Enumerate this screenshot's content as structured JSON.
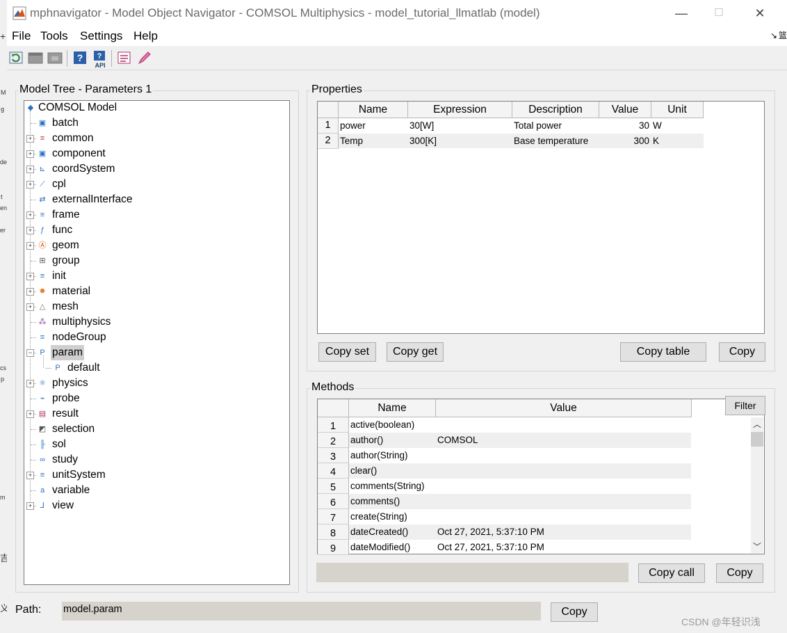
{
  "window": {
    "title": "mphnavigator - Model Object Navigator - COMSOL Multiphysics - model_tutorial_llmatlab (model)",
    "minimize": "—",
    "maximize": "☐",
    "close": "✕"
  },
  "menu": [
    "File",
    "Tools",
    "Settings",
    "Help"
  ],
  "toolbar_icons": [
    "refresh-icon",
    "collapse-icon",
    "expand-icon",
    "help-icon",
    "api-help-icon",
    "list-icon",
    "pen-icon"
  ],
  "toolbar_api_label": "API",
  "tree": {
    "title": "Model Tree - Parameters 1",
    "root": "COMSOL Model",
    "items": [
      {
        "label": "batch",
        "expandable": false,
        "icon": "batch-icon"
      },
      {
        "label": "common",
        "expandable": true,
        "icon": "common-icon"
      },
      {
        "label": "component",
        "expandable": true,
        "icon": "component-icon"
      },
      {
        "label": "coordSystem",
        "expandable": true,
        "icon": "coordsystem-icon"
      },
      {
        "label": "cpl",
        "expandable": true,
        "icon": "cpl-icon"
      },
      {
        "label": "externalInterface",
        "expandable": false,
        "icon": "external-interface-icon"
      },
      {
        "label": "frame",
        "expandable": true,
        "icon": "frame-icon"
      },
      {
        "label": "func",
        "expandable": true,
        "icon": "func-icon"
      },
      {
        "label": "geom",
        "expandable": true,
        "icon": "geom-icon"
      },
      {
        "label": "group",
        "expandable": false,
        "icon": "group-icon"
      },
      {
        "label": "init",
        "expandable": true,
        "icon": "init-icon"
      },
      {
        "label": "material",
        "expandable": true,
        "icon": "material-icon"
      },
      {
        "label": "mesh",
        "expandable": true,
        "icon": "mesh-icon"
      },
      {
        "label": "multiphysics",
        "expandable": false,
        "icon": "multiphysics-icon"
      },
      {
        "label": "nodeGroup",
        "expandable": false,
        "icon": "nodegroup-icon"
      },
      {
        "label": "param",
        "expandable": true,
        "expanded": true,
        "selected": true,
        "icon": "param-icon"
      },
      {
        "label": "default",
        "child": true,
        "icon": "param-icon"
      },
      {
        "label": "physics",
        "expandable": true,
        "icon": "physics-icon"
      },
      {
        "label": "probe",
        "expandable": false,
        "icon": "probe-icon"
      },
      {
        "label": "result",
        "expandable": true,
        "icon": "result-icon"
      },
      {
        "label": "selection",
        "expandable": false,
        "icon": "selection-icon"
      },
      {
        "label": "sol",
        "expandable": false,
        "icon": "sol-icon"
      },
      {
        "label": "study",
        "expandable": false,
        "icon": "study-icon"
      },
      {
        "label": "unitSystem",
        "expandable": true,
        "icon": "unitsystem-icon"
      },
      {
        "label": "variable",
        "expandable": false,
        "icon": "variable-icon"
      },
      {
        "label": "view",
        "expandable": true,
        "icon": "view-icon"
      }
    ],
    "icon_glyphs": {
      "root": "◆",
      "func": "f(x)",
      "param": "P¦",
      "variable": "a=",
      "coord": "zyx"
    }
  },
  "properties": {
    "title": "Properties",
    "columns": [
      "Name",
      "Expression",
      "Description",
      "Value",
      "Unit"
    ],
    "rows": [
      {
        "n": "1",
        "name": "power",
        "expression": "30[W]",
        "description": "Total power",
        "value": "30",
        "unit": "W"
      },
      {
        "n": "2",
        "name": "Temp",
        "expression": "300[K]",
        "description": "Base temperature",
        "value": "300",
        "unit": "K"
      }
    ],
    "buttons": {
      "copy_set": "Copy set",
      "copy_get": "Copy get",
      "copy_table": "Copy table",
      "copy": "Copy"
    }
  },
  "methods": {
    "title": "Methods",
    "columns": [
      "Name",
      "Value"
    ],
    "filter": "Filter",
    "rows": [
      {
        "n": "1",
        "name": "active(boolean)",
        "value": ""
      },
      {
        "n": "2",
        "name": "author()",
        "value": "COMSOL"
      },
      {
        "n": "3",
        "name": "author(String)",
        "value": ""
      },
      {
        "n": "4",
        "name": "clear()",
        "value": ""
      },
      {
        "n": "5",
        "name": "comments(String)",
        "value": ""
      },
      {
        "n": "6",
        "name": "comments()",
        "value": ""
      },
      {
        "n": "7",
        "name": "create(String)",
        "value": ""
      },
      {
        "n": "8",
        "name": "dateCreated()",
        "value": "Oct 27, 2021, 5:37:10 PM"
      },
      {
        "n": "9",
        "name": "dateModified()",
        "value": "Oct 27, 2021, 5:37:10 PM"
      }
    ],
    "scroll_up": "︿",
    "scroll_down": "﹀",
    "call_field": "",
    "buttons": {
      "copy_call": "Copy call",
      "copy": "Copy"
    }
  },
  "path": {
    "label": "Path:",
    "value": "model.param",
    "copy": "Copy"
  },
  "watermark": "CSDN @年轻识浅",
  "bg_fragments": [
    "+",
    "M",
    "g",
    "de",
    "t",
    "en",
    "er",
    "cs",
    "p",
    "m",
    "吉",
    "义",
    "↘",
    "篮"
  ]
}
